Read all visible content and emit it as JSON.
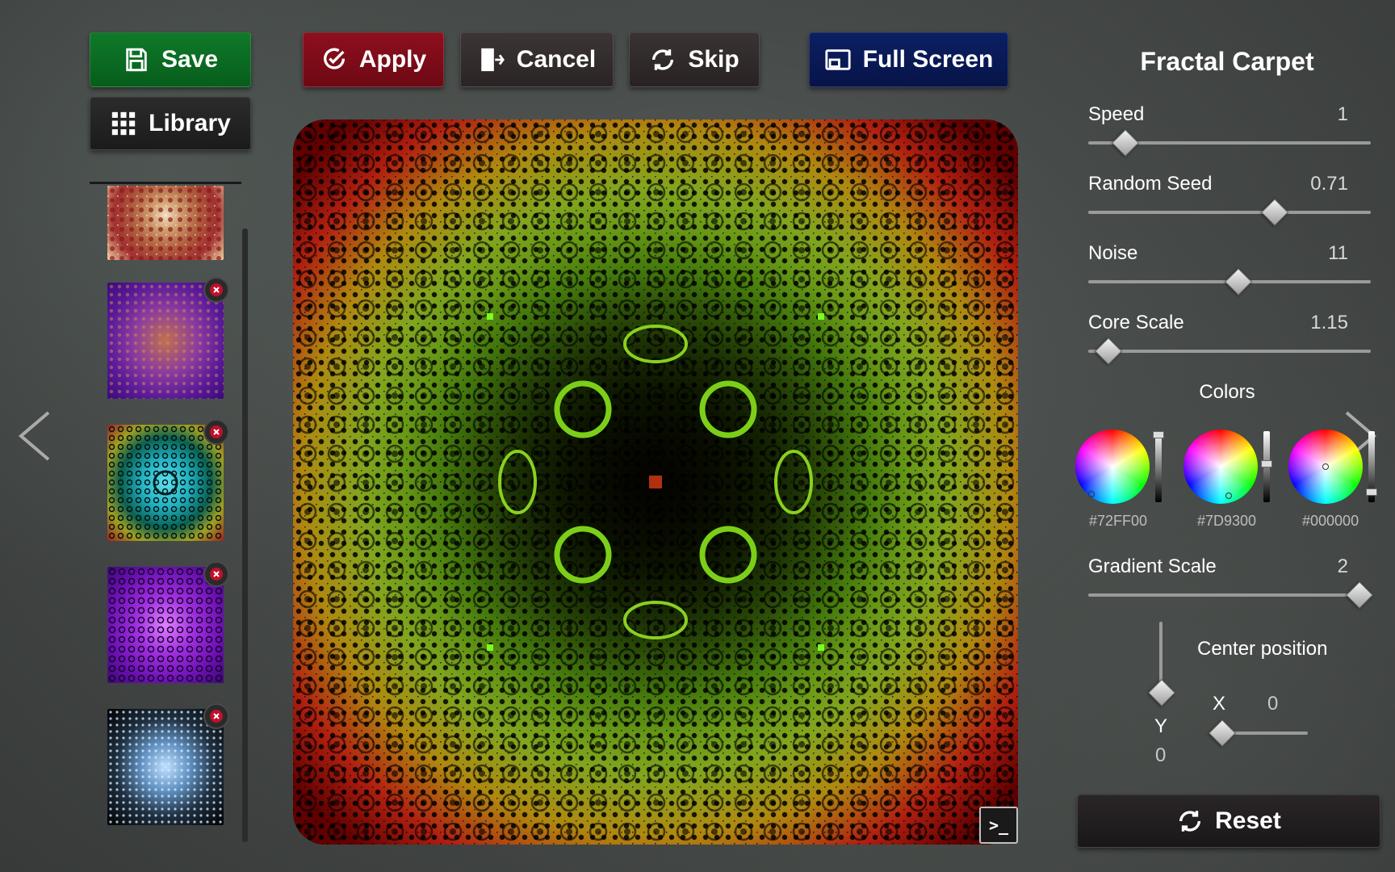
{
  "toolbar": {
    "save_label": "Save",
    "library_label": "Library",
    "apply_label": "Apply",
    "cancel_label": "Cancel",
    "skip_label": "Skip",
    "fullscreen_label": "Full Screen"
  },
  "colors": {
    "save": "#0b6b22",
    "apply": "#7d0c19",
    "fullscreen": "#081a58"
  },
  "canvas": {
    "terminal_label": ">_"
  },
  "panel": {
    "title": "Fractal Carpet",
    "sliders": [
      {
        "label": "Speed",
        "value": "1",
        "fraction": 0.13
      },
      {
        "label": "Random Seed",
        "value": "0.71",
        "fraction": 0.66
      },
      {
        "label": "Noise",
        "value": "11",
        "fraction": 0.53
      },
      {
        "label": "Core Scale",
        "value": "1.15",
        "fraction": 0.07
      }
    ],
    "colors_title": "Colors",
    "color_swatches": [
      {
        "hex": "#72FF00",
        "brightness": 0.0
      },
      {
        "hex": "#7D9300",
        "brightness": 0.45
      },
      {
        "hex": "#000000",
        "brightness": 0.9
      }
    ],
    "gradient": {
      "label": "Gradient Scale",
      "value": "2",
      "fraction": 0.96
    },
    "center": {
      "title": "Center position",
      "x_label": "X",
      "x_value": "0",
      "y_label": "Y",
      "y_value": "0"
    },
    "reset_label": "Reset"
  }
}
